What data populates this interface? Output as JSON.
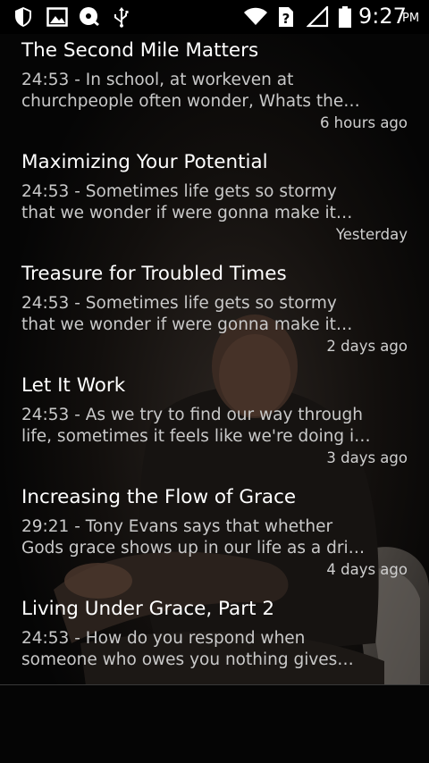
{
  "status_bar": {
    "left_icons": [
      "shield-icon",
      "image-icon",
      "podcast-icon",
      "usb-icon"
    ],
    "right_icons": [
      "wifi-icon",
      "unknown-sim-icon",
      "signal-icon",
      "battery-icon"
    ],
    "time": "9:27",
    "ampm": "PM"
  },
  "episodes": [
    {
      "title": "The Second Mile Matters",
      "desc_line1": "24:53 - In school, at workeven at",
      "desc_line2": "churchpeople often wonder, Whats the…",
      "time": "6 hours ago"
    },
    {
      "title": "Maximizing Your Potential",
      "desc_line1": "24:53 - Sometimes life gets so stormy",
      "desc_line2": "that we wonder if were gonna make it…",
      "time": "Yesterday"
    },
    {
      "title": "Treasure for Troubled Times",
      "desc_line1": "24:53 - Sometimes life gets so stormy",
      "desc_line2": "that we wonder if were gonna make it…",
      "time": "2 days ago"
    },
    {
      "title": "Let It Work",
      "desc_line1": "24:53 - As we try to find our way through",
      "desc_line2": "life, sometimes it feels like we're doing i…",
      "time": "3 days ago"
    },
    {
      "title": "Increasing the Flow of Grace",
      "desc_line1": "29:21 - Tony Evans says that whether",
      "desc_line2": "Gods grace shows up in our life as a dri…",
      "time": "4 days ago"
    },
    {
      "title": "Living Under Grace, Part 2",
      "desc_line1": "24:53 - How do you respond when",
      "desc_line2": "someone who owes you nothing gives…",
      "time": ""
    }
  ],
  "colors": {
    "title": "#ffffff",
    "description": "#c9c9c9",
    "timestamp": "#cfcfcf",
    "background": "#050505"
  }
}
